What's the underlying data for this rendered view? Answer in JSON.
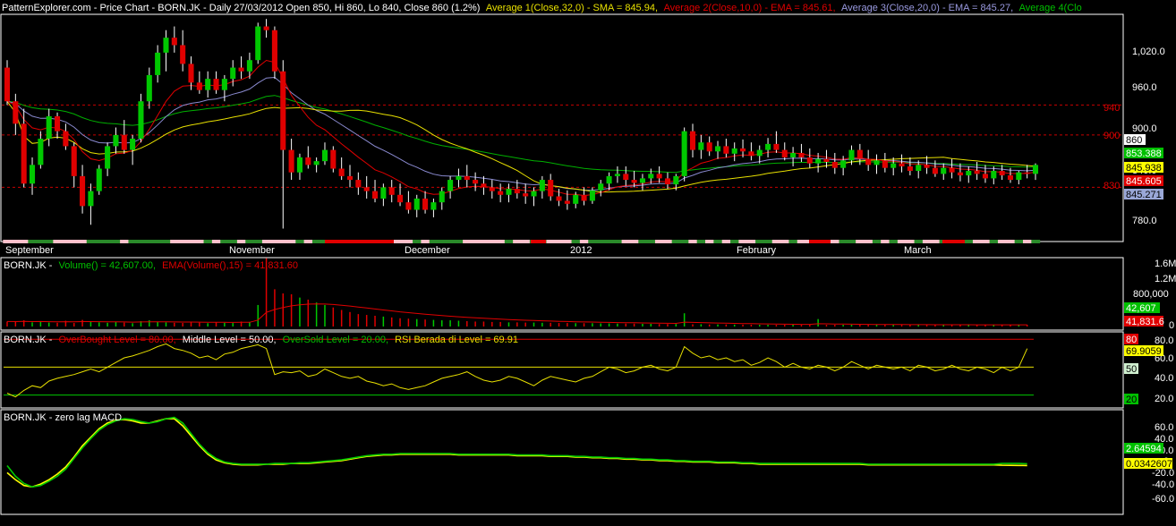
{
  "header": {
    "source": "PatternExplorer.com",
    "title": "Price Chart",
    "symbol": "BORN.JK",
    "info": "Daily 27/03/2012 Open 850, Hi 860, Lo 840, Close 860 (1.2%)",
    "avg1": "Average 1(Close,32,0) - SMA = 845.94,",
    "avg2": "Average 2(Close,10,0) - EMA = 845.61,",
    "avg3": "Average 3(Close,20,0) - EMA = 845.27,",
    "avg4": "Average 4(Clo"
  },
  "colors": {
    "background": "#000000",
    "frame": "#ffffff",
    "up_candle": "#00c800",
    "down_candle": "#e00000",
    "wick": "#ffffff",
    "sma32": "#e8e000",
    "ema10": "#e00000",
    "ema20": "#8a8ad0",
    "ema_green": "#00b000",
    "level_line": "#c80000",
    "rsi_line": "#e8e000",
    "overbought": "#e00000",
    "middle": "#e8e000",
    "oversold": "#00c800",
    "macd_main": "#00c800",
    "macd_signal": "#ffff00"
  },
  "price_panel": {
    "y_ticks": [
      "1,020.0",
      "960.0",
      "900.0",
      "840.0",
      "780.0"
    ],
    "level_labels": [
      "940",
      "900",
      "830"
    ],
    "last_labels": {
      "close": "860",
      "green": "853.388",
      "sma": "845.938",
      "ema10": "845.605",
      "ema20": "845.271"
    },
    "month_labels": [
      "September",
      "November",
      "December",
      "2012",
      "February",
      "March"
    ]
  },
  "volume_panel": {
    "label_symbol": "BORN.JK -",
    "label_volume": "Volume() = 42,607.00,",
    "label_ema": "EMA(Volume(),15) = 41,831.60",
    "y_ticks": [
      "1.6M",
      "1.2M",
      "800,000",
      "0"
    ],
    "last_volume": "42,607",
    "last_ema": "41,831.6"
  },
  "rsi_panel": {
    "label_symbol": "BORN.JK -",
    "label_ob": "OverBought Level = 80.00,",
    "label_mid": "Middle Level = 50.00,",
    "label_os": "OverSold Level = 20.00,",
    "label_rsi": "RSI Berada di Level = 69.91",
    "y_ticks": [
      "80.0",
      "60.0",
      "40.0",
      "20.0"
    ],
    "last_ob": "80",
    "last_rsi": "69.9059",
    "last_mid": "50",
    "last_os": "20"
  },
  "macd_panel": {
    "label": "BORN.JK - zero lag MACD",
    "y_ticks": [
      "60.0",
      "40.0",
      "20.0",
      "0",
      "-20.0",
      "-40.0",
      "-60.0"
    ],
    "last_main": "2.64594",
    "last_signal": "0.0342607"
  },
  "chart_data": {
    "type": "candlestick",
    "title": "BORN.JK - Daily",
    "price_range": [
      760,
      1060
    ],
    "levels": [
      940,
      900,
      830
    ],
    "candles": [
      [
        990,
        1000,
        940,
        945
      ],
      [
        945,
        955,
        900,
        915
      ],
      [
        915,
        935,
        830,
        835
      ],
      [
        835,
        870,
        820,
        860
      ],
      [
        860,
        905,
        855,
        895
      ],
      [
        895,
        935,
        885,
        925
      ],
      [
        925,
        930,
        895,
        905
      ],
      [
        905,
        915,
        880,
        885
      ],
      [
        885,
        890,
        830,
        845
      ],
      [
        845,
        860,
        795,
        805
      ],
      [
        805,
        835,
        780,
        825
      ],
      [
        825,
        860,
        820,
        855
      ],
      [
        855,
        890,
        845,
        885
      ],
      [
        885,
        910,
        875,
        900
      ],
      [
        900,
        920,
        875,
        880
      ],
      [
        880,
        900,
        860,
        895
      ],
      [
        895,
        955,
        890,
        945
      ],
      [
        945,
        990,
        935,
        980
      ],
      [
        980,
        1020,
        970,
        1010
      ],
      [
        1010,
        1040,
        985,
        1030
      ],
      [
        1030,
        1045,
        1010,
        1020
      ],
      [
        1020,
        1040,
        985,
        995
      ],
      [
        995,
        1005,
        960,
        970
      ],
      [
        970,
        985,
        955,
        960
      ],
      [
        960,
        985,
        950,
        975
      ],
      [
        975,
        985,
        955,
        960
      ],
      [
        960,
        980,
        945,
        975
      ],
      [
        975,
        1000,
        965,
        990
      ],
      [
        990,
        1005,
        975,
        985
      ],
      [
        985,
        1010,
        975,
        1000
      ],
      [
        1000,
        1050,
        995,
        1045
      ],
      [
        1045,
        1055,
        1030,
        1040
      ],
      [
        1040,
        1045,
        975,
        985
      ],
      [
        985,
        1000,
        775,
        880
      ],
      [
        880,
        895,
        840,
        850
      ],
      [
        850,
        875,
        840,
        870
      ],
      [
        870,
        885,
        855,
        860
      ],
      [
        860,
        870,
        850,
        865
      ],
      [
        865,
        890,
        860,
        880
      ],
      [
        880,
        885,
        850,
        855
      ],
      [
        855,
        870,
        840,
        845
      ],
      [
        845,
        860,
        830,
        840
      ],
      [
        840,
        850,
        820,
        830
      ],
      [
        830,
        845,
        815,
        825
      ],
      [
        825,
        840,
        810,
        815
      ],
      [
        815,
        835,
        805,
        830
      ],
      [
        830,
        840,
        810,
        820
      ],
      [
        820,
        835,
        805,
        810
      ],
      [
        810,
        825,
        795,
        800
      ],
      [
        800,
        820,
        790,
        815
      ],
      [
        815,
        825,
        795,
        800
      ],
      [
        800,
        815,
        790,
        810
      ],
      [
        810,
        830,
        800,
        825
      ],
      [
        825,
        845,
        815,
        840
      ],
      [
        840,
        855,
        830,
        845
      ],
      [
        845,
        860,
        830,
        840
      ],
      [
        840,
        850,
        825,
        835
      ],
      [
        835,
        845,
        820,
        830
      ],
      [
        830,
        840,
        815,
        825
      ],
      [
        825,
        835,
        810,
        820
      ],
      [
        820,
        835,
        810,
        828
      ],
      [
        828,
        840,
        815,
        822
      ],
      [
        822,
        835,
        808,
        818
      ],
      [
        818,
        830,
        805,
        825
      ],
      [
        825,
        845,
        815,
        840
      ],
      [
        840,
        848,
        812,
        818
      ],
      [
        818,
        828,
        805,
        812
      ],
      [
        812,
        826,
        800,
        808
      ],
      [
        808,
        824,
        802,
        820
      ],
      [
        820,
        830,
        806,
        812
      ],
      [
        812,
        830,
        808,
        826
      ],
      [
        826,
        840,
        818,
        835
      ],
      [
        835,
        850,
        826,
        845
      ],
      [
        845,
        858,
        836,
        848
      ],
      [
        848,
        858,
        832,
        840
      ],
      [
        840,
        852,
        830,
        836
      ],
      [
        836,
        848,
        826,
        842
      ],
      [
        842,
        855,
        835,
        848
      ],
      [
        848,
        858,
        836,
        842
      ],
      [
        842,
        850,
        828,
        834
      ],
      [
        834,
        848,
        826,
        845
      ],
      [
        845,
        910,
        838,
        905
      ],
      [
        905,
        915,
        870,
        880
      ],
      [
        880,
        900,
        868,
        890
      ],
      [
        890,
        898,
        872,
        878
      ],
      [
        878,
        892,
        868,
        885
      ],
      [
        885,
        895,
        870,
        875
      ],
      [
        875,
        890,
        865,
        882
      ],
      [
        882,
        894,
        870,
        878
      ],
      [
        878,
        890,
        866,
        872
      ],
      [
        872,
        886,
        862,
        880
      ],
      [
        880,
        896,
        870,
        888
      ],
      [
        888,
        905,
        876,
        880
      ],
      [
        880,
        890,
        866,
        870
      ],
      [
        870,
        884,
        858,
        876
      ],
      [
        876,
        888,
        864,
        870
      ],
      [
        870,
        882,
        856,
        862
      ],
      [
        862,
        876,
        850,
        868
      ],
      [
        868,
        880,
        856,
        864
      ],
      [
        864,
        876,
        848,
        856
      ],
      [
        856,
        872,
        846,
        866
      ],
      [
        866,
        886,
        860,
        880
      ],
      [
        880,
        888,
        860,
        868
      ],
      [
        868,
        880,
        852,
        860
      ],
      [
        860,
        874,
        848,
        866
      ],
      [
        866,
        876,
        850,
        856
      ],
      [
        856,
        870,
        846,
        862
      ],
      [
        862,
        874,
        850,
        858
      ],
      [
        858,
        870,
        846,
        852
      ],
      [
        852,
        866,
        842,
        860
      ],
      [
        860,
        872,
        848,
        856
      ],
      [
        856,
        866,
        844,
        848
      ],
      [
        848,
        862,
        840,
        856
      ],
      [
        856,
        868,
        842,
        850
      ],
      [
        850,
        862,
        838,
        846
      ],
      [
        846,
        858,
        836,
        852
      ],
      [
        852,
        864,
        840,
        848
      ],
      [
        848,
        860,
        836,
        842
      ],
      [
        842,
        858,
        834,
        852
      ],
      [
        852,
        860,
        840,
        846
      ],
      [
        846,
        856,
        836,
        840
      ],
      [
        840,
        852,
        834,
        850
      ],
      [
        850,
        860,
        842,
        848
      ],
      [
        848,
        862,
        840,
        860
      ]
    ],
    "volume_max": 1600000,
    "volume": [
      120,
      110,
      150,
      100,
      130,
      95,
      90,
      140,
      85,
      160,
      120,
      100,
      90,
      110,
      95,
      80,
      130,
      150,
      120,
      100,
      90,
      85,
      110,
      95,
      80,
      100,
      90,
      85,
      120,
      110,
      520,
      1650,
      900,
      800,
      780,
      700,
      650,
      580,
      520,
      460,
      400,
      350,
      300,
      280,
      260,
      240,
      220,
      200,
      190,
      180,
      170,
      160,
      150,
      150,
      140,
      130,
      120,
      120,
      110,
      110,
      100,
      100,
      95,
      95,
      90,
      90,
      85,
      85,
      80,
      80,
      80,
      75,
      75,
      70,
      70,
      70,
      65,
      65,
      60,
      60,
      60,
      320,
      55,
      55,
      50,
      50,
      50,
      45,
      45,
      45,
      40,
      40,
      40,
      40,
      40,
      40,
      40,
      180,
      40,
      40,
      40,
      40,
      40,
      40,
      40,
      40,
      40,
      40,
      40,
      40,
      40,
      40,
      40,
      40,
      40,
      40,
      40,
      40,
      40,
      40,
      40,
      40,
      42
    ],
    "rsi": [
      22,
      18,
      25,
      30,
      28,
      35,
      38,
      40,
      42,
      45,
      48,
      45,
      50,
      55,
      60,
      62,
      65,
      68,
      72,
      75,
      70,
      68,
      65,
      60,
      62,
      58,
      64,
      66,
      70,
      72,
      74,
      70,
      42,
      45,
      44,
      46,
      40,
      42,
      48,
      44,
      40,
      38,
      40,
      35,
      33,
      30,
      32,
      28,
      26,
      28,
      30,
      34,
      38,
      40,
      42,
      45,
      40,
      36,
      34,
      36,
      40,
      38,
      34,
      30,
      36,
      40,
      38,
      36,
      34,
      38,
      40,
      45,
      50,
      48,
      44,
      46,
      50,
      52,
      48,
      46,
      50,
      72,
      65,
      60,
      62,
      58,
      60,
      56,
      58,
      52,
      55,
      60,
      56,
      50,
      54,
      50,
      48,
      52,
      50,
      46,
      50,
      56,
      52,
      48,
      52,
      50,
      48,
      50,
      46,
      52,
      50,
      46,
      48,
      52,
      48,
      46,
      50,
      48,
      44,
      50,
      46,
      50,
      69.91
    ],
    "macd": [
      0,
      -15,
      -25,
      -30,
      -28,
      -22,
      -15,
      -5,
      10,
      25,
      38,
      50,
      58,
      63,
      66,
      65,
      62,
      60,
      62,
      66,
      68,
      60,
      45,
      30,
      18,
      10,
      5,
      3,
      2,
      2,
      2,
      2,
      3,
      3,
      3,
      4,
      4,
      5,
      6,
      7,
      8,
      10,
      12,
      14,
      15,
      16,
      16,
      17,
      17,
      17,
      17,
      17,
      17,
      17,
      16,
      16,
      16,
      16,
      16,
      16,
      16,
      15,
      15,
      15,
      15,
      14,
      14,
      14,
      13,
      13,
      12,
      12,
      11,
      11,
      10,
      10,
      9,
      9,
      8,
      8,
      7,
      7,
      6,
      6,
      6,
      5,
      5,
      5,
      4,
      4,
      3,
      3,
      3,
      3,
      3,
      3,
      3,
      3,
      3,
      3,
      3,
      3,
      3,
      2,
      2,
      2,
      2,
      2,
      2,
      2,
      2,
      2,
      2,
      2,
      2,
      2,
      2,
      2,
      2,
      3,
      3,
      3,
      2.65
    ],
    "macd_signal": [
      -10,
      -20,
      -28,
      -30,
      -26,
      -20,
      -12,
      -2,
      12,
      28,
      40,
      52,
      60,
      64,
      65,
      63,
      60,
      60,
      63,
      66,
      66,
      56,
      42,
      28,
      16,
      8,
      4,
      2,
      1,
      1,
      1,
      2,
      2,
      2,
      3,
      3,
      3,
      4,
      5,
      6,
      7,
      9,
      11,
      13,
      14,
      15,
      15,
      16,
      16,
      16,
      16,
      16,
      16,
      16,
      15,
      15,
      15,
      15,
      15,
      15,
      15,
      14,
      14,
      14,
      14,
      13,
      13,
      13,
      12,
      12,
      11,
      11,
      10,
      10,
      9,
      9,
      8,
      8,
      7,
      7,
      6,
      6,
      5,
      5,
      5,
      4,
      4,
      4,
      3,
      3,
      2,
      2,
      2,
      2,
      2,
      2,
      2,
      2,
      2,
      2,
      2,
      2,
      2,
      1,
      1,
      1,
      1,
      1,
      1,
      1,
      1,
      1,
      1,
      1,
      1,
      1,
      1,
      1,
      1,
      0.5,
      0.3,
      0.2,
      0.03
    ]
  }
}
